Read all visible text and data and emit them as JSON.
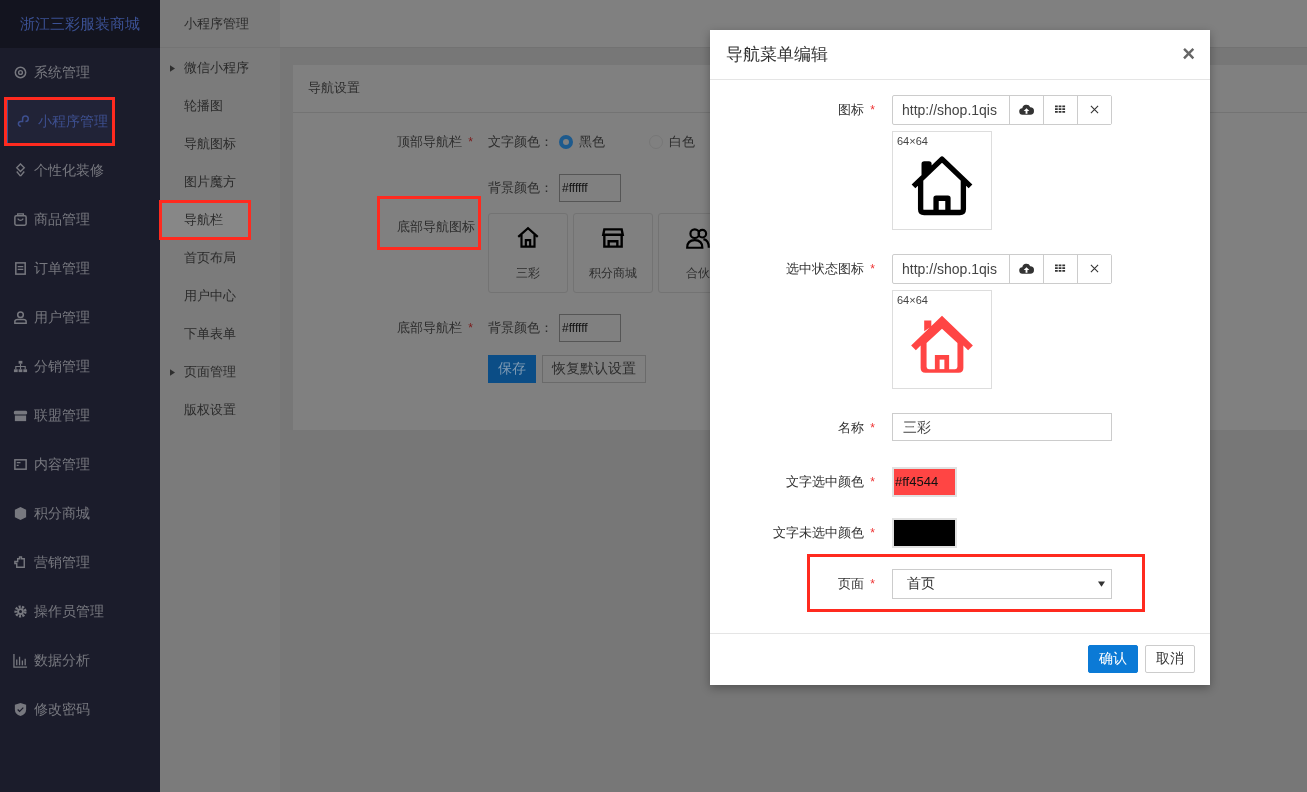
{
  "app": {
    "title": "浙江三彩服装商城"
  },
  "sidebar": {
    "items": [
      {
        "label": "系统管理",
        "selected": false,
        "highlighted": false
      },
      {
        "label": "小程序管理",
        "selected": true,
        "highlighted": true
      },
      {
        "label": "个性化装修",
        "selected": false,
        "highlighted": false
      },
      {
        "label": "商品管理",
        "selected": false,
        "highlighted": false
      },
      {
        "label": "订单管理",
        "selected": false,
        "highlighted": false
      },
      {
        "label": "用户管理",
        "selected": false,
        "highlighted": false
      },
      {
        "label": "分销管理",
        "selected": false,
        "highlighted": false
      },
      {
        "label": "联盟管理",
        "selected": false,
        "highlighted": false
      },
      {
        "label": "内容管理",
        "selected": false,
        "highlighted": false
      },
      {
        "label": "积分商城",
        "selected": false,
        "highlighted": false
      },
      {
        "label": "营销管理",
        "selected": false,
        "highlighted": false
      },
      {
        "label": "操作员管理",
        "selected": false,
        "highlighted": false
      },
      {
        "label": "数据分析",
        "selected": false,
        "highlighted": false
      },
      {
        "label": "修改密码",
        "selected": false,
        "highlighted": false
      }
    ]
  },
  "submenu": {
    "title": "小程序管理",
    "items": [
      {
        "label": "微信小程序",
        "expandable": true,
        "selected": false,
        "highlighted": false
      },
      {
        "label": "轮播图",
        "expandable": false,
        "selected": false,
        "highlighted": false
      },
      {
        "label": "导航图标",
        "expandable": false,
        "selected": false,
        "highlighted": false
      },
      {
        "label": "图片魔方",
        "expandable": false,
        "selected": false,
        "highlighted": false
      },
      {
        "label": "导航栏",
        "expandable": false,
        "selected": true,
        "highlighted": true
      },
      {
        "label": "首页布局",
        "expandable": false,
        "selected": false,
        "highlighted": false
      },
      {
        "label": "用户中心",
        "expandable": false,
        "selected": false,
        "highlighted": false
      },
      {
        "label": "下单表单",
        "expandable": false,
        "selected": false,
        "highlighted": false
      },
      {
        "label": "页面管理",
        "expandable": true,
        "selected": false,
        "highlighted": false
      },
      {
        "label": "版权设置",
        "expandable": false,
        "selected": false,
        "highlighted": false
      }
    ]
  },
  "card": {
    "title": "导航设置",
    "top_bar": {
      "label": "顶部导航栏",
      "required_mark": "*",
      "text_color_label": "文字颜色：",
      "options": [
        {
          "label": "黑色",
          "selected": true
        },
        {
          "label": "白色",
          "selected": false
        }
      ],
      "bg_label": "背景颜色：",
      "bg_value": "#ffffff"
    },
    "bottom_icons": {
      "label": "底部导航图标",
      "highlighted": true,
      "tiles": [
        {
          "label": "三彩"
        },
        {
          "label": "积分商城"
        },
        {
          "label": "合伙"
        }
      ]
    },
    "bottom_bar": {
      "label": "底部导航栏",
      "required_mark": "*",
      "bg_label": "背景颜色：",
      "bg_value": "#ffffff"
    },
    "buttons": [
      {
        "label": "保存",
        "kind": "primary"
      },
      {
        "label": "恢复默认设置",
        "kind": "default"
      }
    ]
  },
  "modal": {
    "title": "导航菜单编辑",
    "close": "×",
    "fields": [
      {
        "kind": "image",
        "label": "图标",
        "required_mark": "*",
        "value": "http://shop.1qis",
        "size": "64×64",
        "color": "#000000",
        "highlighted": false
      },
      {
        "kind": "image",
        "label": "选中状态图标",
        "required_mark": "*",
        "value": "http://shop.1qis",
        "size": "64×64",
        "color": "#ff4544",
        "highlighted": false
      },
      {
        "kind": "text",
        "label": "名称",
        "required_mark": "*",
        "value": "三彩",
        "highlighted": false
      },
      {
        "kind": "color",
        "label": "文字选中颜色",
        "required_mark": "*",
        "value": "#ff4544",
        "color": "#ff4544",
        "highlighted": false
      },
      {
        "kind": "color",
        "label": "文字未选中颜色",
        "required_mark": "*",
        "color": "#000000",
        "highlighted": false
      },
      {
        "kind": "select",
        "label": "页面",
        "required_mark": "*",
        "value": "首页",
        "highlighted": true
      }
    ],
    "buttons": [
      {
        "label": "确认",
        "kind": "primary"
      },
      {
        "label": "取消",
        "kind": "default"
      }
    ]
  }
}
